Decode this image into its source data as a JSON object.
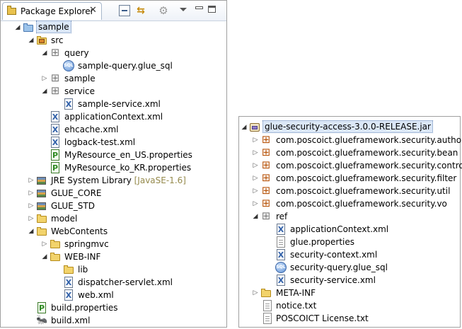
{
  "explorer": {
    "tab_title": "Package Explorer",
    "tab_close": "✕",
    "toolbar": {
      "collapse_icon": "collapse-all-icon",
      "link_icon": "link-with-editor-icon",
      "focus_icon": "focus-icon",
      "menu_icon": "view-menu-icon",
      "minimize_icon": "minimize-icon",
      "maximize_icon": "maximize-icon"
    },
    "items": [
      {
        "label": "sample",
        "icon": "project-icon",
        "state": "expanded",
        "selected": true
      },
      {
        "label": "src",
        "icon": "source-folder-icon",
        "state": "expanded"
      },
      {
        "label": "query",
        "icon": "package-icon",
        "state": "expanded"
      },
      {
        "label": "sample-query.glue_sql",
        "icon": "sql-file-icon"
      },
      {
        "label": "sample",
        "icon": "package-icon",
        "state": "collapsed"
      },
      {
        "label": "service",
        "icon": "package-icon",
        "state": "expanded"
      },
      {
        "label": "sample-service.xml",
        "icon": "xml-file-icon"
      },
      {
        "label": "applicationContext.xml",
        "icon": "xml-file-icon"
      },
      {
        "label": "ehcache.xml",
        "icon": "xml-file-icon"
      },
      {
        "label": "logback-test.xml",
        "icon": "xml-file-icon"
      },
      {
        "label": "MyResource_en_US.properties",
        "icon": "properties-file-icon"
      },
      {
        "label": "MyResource_ko_KR.properties",
        "icon": "properties-file-icon"
      },
      {
        "label": "JRE System Library",
        "decoration": "[JavaSE-1.6]",
        "icon": "library-icon",
        "state": "collapsed"
      },
      {
        "label": "GLUE_CORE",
        "icon": "library-icon",
        "state": "collapsed"
      },
      {
        "label": "GLUE_STD",
        "icon": "library-icon",
        "state": "collapsed"
      },
      {
        "label": "model",
        "icon": "folder-icon",
        "state": "collapsed"
      },
      {
        "label": "WebContents",
        "icon": "folder-icon",
        "state": "expanded"
      },
      {
        "label": "springmvc",
        "icon": "folder-icon",
        "state": "collapsed"
      },
      {
        "label": "WEB-INF",
        "icon": "folder-icon",
        "state": "expanded"
      },
      {
        "label": "lib",
        "icon": "folder-icon"
      },
      {
        "label": "dispatcher-servlet.xml",
        "icon": "xml-file-icon"
      },
      {
        "label": "web.xml",
        "icon": "xml-file-icon"
      },
      {
        "label": "build.properties",
        "icon": "properties-file-icon"
      },
      {
        "label": "build.xml",
        "icon": "ant-file-icon"
      }
    ]
  },
  "jar_view": {
    "items": [
      {
        "label": "glue-security-access-3.0.0-RELEASE.jar",
        "icon": "jar-icon",
        "state": "expanded",
        "selected": true
      },
      {
        "label": "com.poscoict.glueframework.security.authority",
        "icon": "package-icon",
        "state": "collapsed"
      },
      {
        "label": "com.poscoict.glueframework.security.bean",
        "icon": "package-icon",
        "state": "collapsed"
      },
      {
        "label": "com.poscoict.glueframework.security.controller",
        "icon": "package-icon",
        "state": "collapsed"
      },
      {
        "label": "com.poscoict.glueframework.security.filter",
        "icon": "package-icon",
        "state": "collapsed"
      },
      {
        "label": "com.poscoict.glueframework.security.util",
        "icon": "package-icon",
        "state": "collapsed"
      },
      {
        "label": "com.poscoict.glueframework.security.vo",
        "icon": "package-icon",
        "state": "collapsed"
      },
      {
        "label": "ref",
        "icon": "package-icon",
        "state": "expanded"
      },
      {
        "label": "applicationContext.xml",
        "icon": "xml-file-icon"
      },
      {
        "label": "glue.properties",
        "icon": "text-file-icon"
      },
      {
        "label": "security-context.xml",
        "icon": "xml-file-icon"
      },
      {
        "label": "security-query.glue_sql",
        "icon": "sql-file-icon"
      },
      {
        "label": "security-service.xml",
        "icon": "xml-file-icon"
      },
      {
        "label": "META-INF",
        "icon": "folder-icon",
        "state": "collapsed"
      },
      {
        "label": "notice.txt",
        "icon": "text-file-icon"
      },
      {
        "label": "POSCOICT License.txt",
        "icon": "text-file-icon"
      }
    ]
  },
  "glyphs": {
    "expanded": "◢",
    "collapsed": "▷",
    "xml": "X",
    "prop": "P",
    "sql": "SQL",
    "ant": "🐜"
  }
}
